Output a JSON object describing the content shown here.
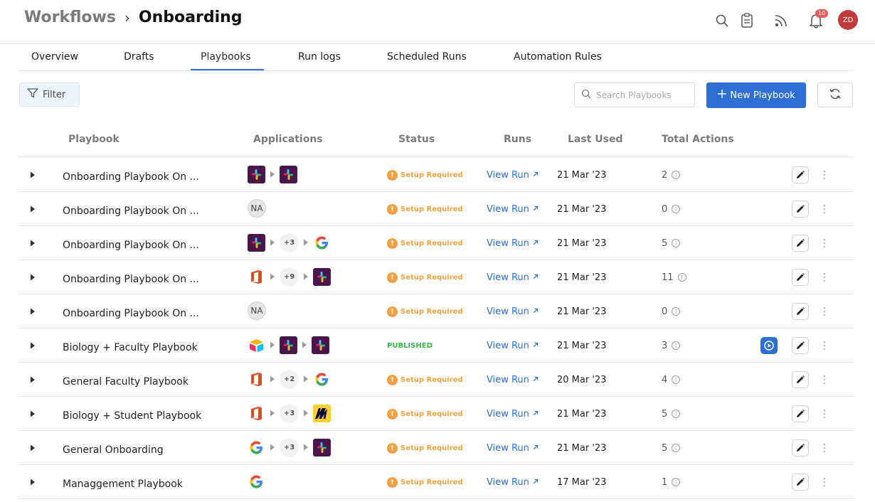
{
  "breadcrumb": {
    "parent": "Workflows",
    "separator": "›",
    "current": "Onboarding"
  },
  "header": {
    "notifications_count": "10",
    "avatar_initials": "ZD"
  },
  "tabs": [
    {
      "label": "Overview"
    },
    {
      "label": "Drafts"
    },
    {
      "label": "Playbooks"
    },
    {
      "label": "Run logs"
    },
    {
      "label": "Scheduled Runs"
    },
    {
      "label": "Automation Rules"
    }
  ],
  "active_tab": "Playbooks",
  "toolbar": {
    "filter_label": "Filter",
    "search_placeholder": "Search Playbooks",
    "new_button_label": "New Playbook"
  },
  "table": {
    "columns": [
      "Playbook",
      "Applications",
      "Status",
      "Runs",
      "Last Used",
      "Total Actions"
    ],
    "rows": [
      {
        "name": "Onboarding Playbook On ...",
        "apps": [
          "slack",
          "arrow",
          "slack"
        ],
        "status": "Setup Required",
        "runs": "View Run",
        "last_used": "21 Mar '23",
        "total_actions": "2"
      },
      {
        "name": "Onboarding Playbook On ...",
        "apps": [
          "na"
        ],
        "na_label": "NA",
        "status": "Setup Required",
        "runs": "View Run",
        "last_used": "21 Mar '23",
        "total_actions": "0"
      },
      {
        "name": "Onboarding Playbook On ...",
        "apps": [
          "slack",
          "arrow",
          "+3",
          "arrow",
          "google"
        ],
        "status": "Setup Required",
        "runs": "View Run",
        "last_used": "21 Mar '23",
        "total_actions": "5"
      },
      {
        "name": "Onboarding Playbook On ...",
        "apps": [
          "office",
          "arrow",
          "+9",
          "arrow",
          "slack"
        ],
        "status": "Setup Required",
        "runs": "View Run",
        "last_used": "21 Mar '23",
        "total_actions": "11"
      },
      {
        "name": "Onboarding Playbook On ...",
        "apps": [
          "na"
        ],
        "na_label": "NA",
        "status": "Setup Required",
        "runs": "View Run",
        "last_used": "21 Mar '23",
        "total_actions": "0"
      },
      {
        "name": "Biology + Faculty Playbook",
        "apps": [
          "airtable",
          "arrow",
          "slack",
          "arrow",
          "slack"
        ],
        "status": "PUBLISHED",
        "runs": "View Run",
        "last_used": "21 Mar '23",
        "total_actions": "3",
        "has_play": true
      },
      {
        "name": "General Faculty Playbook",
        "apps": [
          "office",
          "arrow",
          "+2",
          "arrow",
          "google"
        ],
        "status": "Setup Required",
        "runs": "View Run",
        "last_used": "20 Mar '23",
        "total_actions": "4"
      },
      {
        "name": "Biology + Student Playbook",
        "apps": [
          "office",
          "arrow",
          "+3",
          "arrow",
          "miro"
        ],
        "status": "Setup Required",
        "runs": "View Run",
        "last_used": "21 Mar '23",
        "total_actions": "5"
      },
      {
        "name": "General Onboarding",
        "apps": [
          "google",
          "arrow",
          "+3",
          "arrow",
          "slack"
        ],
        "status": "Setup Required",
        "runs": "View Run",
        "last_used": "21 Mar '23",
        "total_actions": "5"
      },
      {
        "name": "Managgement Playbook",
        "apps": [
          "google"
        ],
        "status": "Setup Required",
        "runs": "View Run",
        "last_used": "17 Mar '23",
        "total_actions": "1"
      }
    ]
  },
  "colors": {
    "accent": "#2f6fd3",
    "status_setup": "#f0a040",
    "status_published": "#39b24a",
    "slack_bg": "#4a154b",
    "office": "#e64a19",
    "miro_bg": "#ffd02f"
  }
}
